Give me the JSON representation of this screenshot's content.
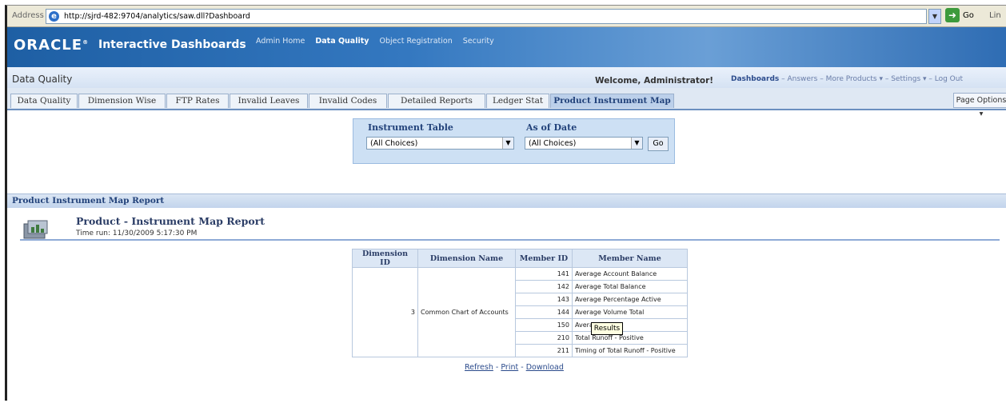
{
  "browser": {
    "address_label": "Address",
    "url": "http://sjrd-482:9704/analytics/saw.dll?Dashboard",
    "go_label": "Go",
    "links_label": "Lin"
  },
  "header": {
    "brand": "ORACLE",
    "product": "Interactive Dashboards",
    "nav": [
      "Admin Home",
      "Data Quality",
      "Object Registration",
      "Security"
    ]
  },
  "dashboard_bar": {
    "title": "Data Quality",
    "welcome": "Welcome, Administrator!",
    "links": {
      "dashboards": "Dashboards",
      "answers": "Answers",
      "more_products": "More Products",
      "settings": "Settings",
      "logout": "Log Out"
    }
  },
  "tabs": [
    "Data Quality",
    "Dimension Wise",
    "FTP Rates",
    "Invalid Leaves",
    "Invalid Codes",
    "Detailed Reports",
    "Ledger Stat",
    "Product Instrument Map"
  ],
  "page_options": "Page Options",
  "prompts": {
    "instrument_table_label": "Instrument Table",
    "instrument_table_value": "(All Choices)",
    "as_of_date_label": "As of Date",
    "as_of_date_value": "(All Choices)",
    "go": "Go"
  },
  "section_title": "Product Instrument Map Report",
  "report": {
    "title": "Product - Instrument Map Report",
    "time_run": "Time run: 11/30/2009 5:17:30 PM",
    "columns": [
      "Dimension ID",
      "Dimension Name",
      "Member ID",
      "Member Name"
    ],
    "dimension_id": "3",
    "dimension_name": "Common Chart of Accounts",
    "rows": [
      {
        "member_id": "141",
        "member_name": "Average Account Balance"
      },
      {
        "member_id": "142",
        "member_name": "Average Total Balance"
      },
      {
        "member_id": "143",
        "member_name": "Average Percentage Active"
      },
      {
        "member_id": "144",
        "member_name": "Average Volume Total"
      },
      {
        "member_id": "150",
        "member_name": "Average ... ate"
      },
      {
        "member_id": "210",
        "member_name": "Total Runoff - Positive"
      },
      {
        "member_id": "211",
        "member_name": "Timing of Total Runoff - Positive"
      }
    ],
    "links": {
      "refresh": "Refresh",
      "print": "Print",
      "download": "Download"
    },
    "tooltip": "Results"
  }
}
